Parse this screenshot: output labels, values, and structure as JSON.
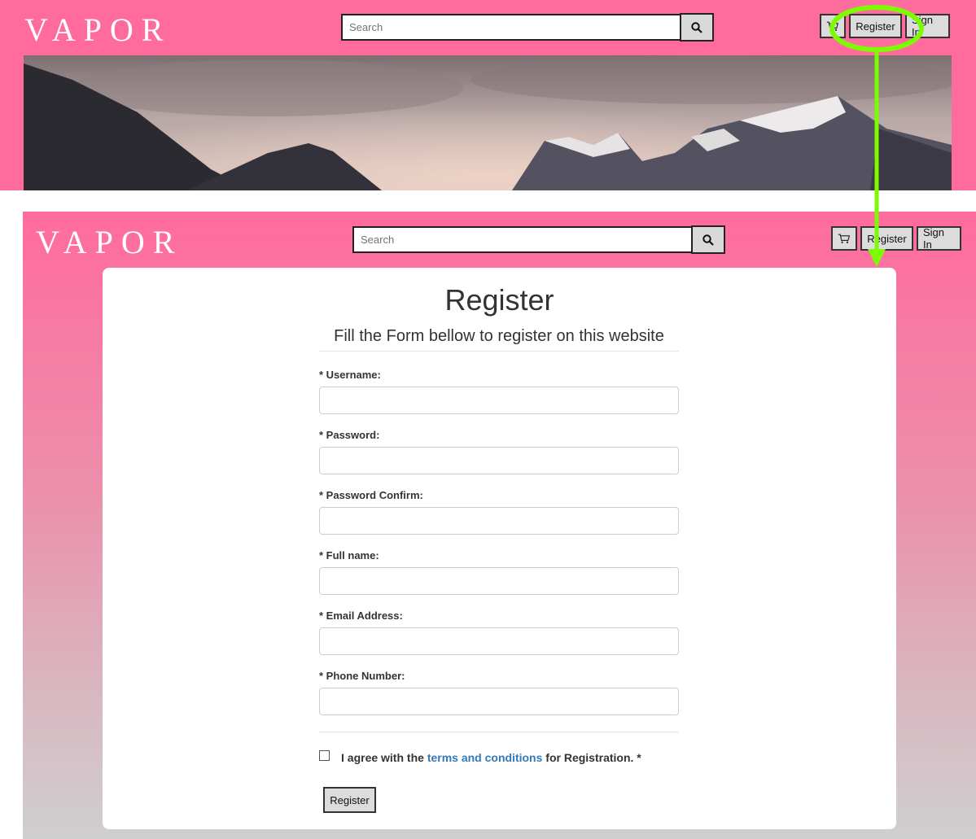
{
  "top": {
    "logo": "VAPOR",
    "search_placeholder": "Search",
    "register_label": "Register",
    "signin_label": "Sign In"
  },
  "main": {
    "logo": "VAPOR",
    "search_placeholder": "Search",
    "register_label": "Register",
    "signin_label": "Sign In"
  },
  "form": {
    "title": "Register",
    "subtitle": "Fill the Form bellow to register on this website",
    "fields": [
      {
        "label": "* Username:"
      },
      {
        "label": "* Password:"
      },
      {
        "label": "* Password Confirm:"
      },
      {
        "label": "* Full name:"
      },
      {
        "label": "* Email Address:"
      },
      {
        "label": "* Phone Number:"
      }
    ],
    "agree_prefix": "I agree with the ",
    "agree_link": "terms and conditions",
    "agree_suffix": " for Registration. *",
    "submit_label": "Register"
  },
  "colors": {
    "header_pink": "#ff6b9d",
    "annotation_green": "#7cfc00",
    "link_blue": "#337ab7"
  },
  "icons": [
    "search-icon",
    "cart-icon"
  ]
}
